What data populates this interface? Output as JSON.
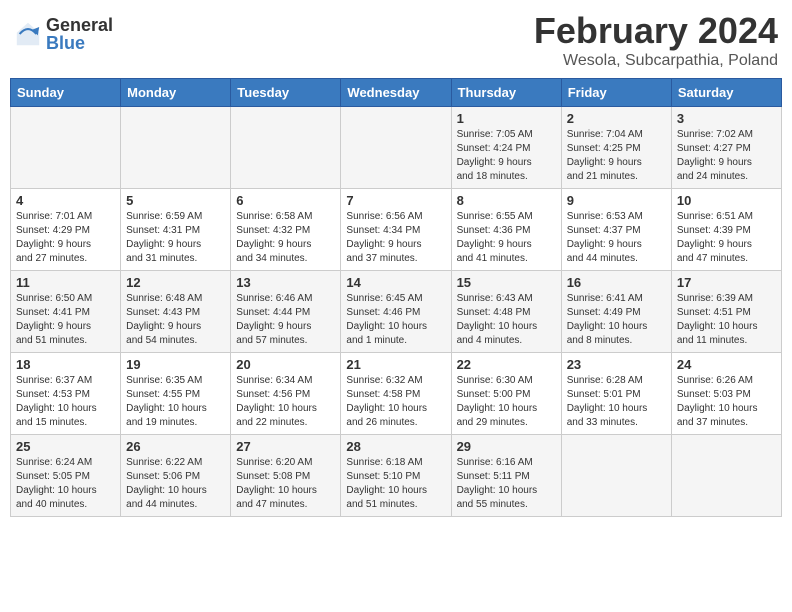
{
  "header": {
    "logo_general": "General",
    "logo_blue": "Blue",
    "month_title": "February 2024",
    "location": "Wesola, Subcarpathia, Poland"
  },
  "days_of_week": [
    "Sunday",
    "Monday",
    "Tuesday",
    "Wednesday",
    "Thursday",
    "Friday",
    "Saturday"
  ],
  "weeks": [
    [
      {
        "day": "",
        "info": ""
      },
      {
        "day": "",
        "info": ""
      },
      {
        "day": "",
        "info": ""
      },
      {
        "day": "",
        "info": ""
      },
      {
        "day": "1",
        "info": "Sunrise: 7:05 AM\nSunset: 4:24 PM\nDaylight: 9 hours\nand 18 minutes."
      },
      {
        "day": "2",
        "info": "Sunrise: 7:04 AM\nSunset: 4:25 PM\nDaylight: 9 hours\nand 21 minutes."
      },
      {
        "day": "3",
        "info": "Sunrise: 7:02 AM\nSunset: 4:27 PM\nDaylight: 9 hours\nand 24 minutes."
      }
    ],
    [
      {
        "day": "4",
        "info": "Sunrise: 7:01 AM\nSunset: 4:29 PM\nDaylight: 9 hours\nand 27 minutes."
      },
      {
        "day": "5",
        "info": "Sunrise: 6:59 AM\nSunset: 4:31 PM\nDaylight: 9 hours\nand 31 minutes."
      },
      {
        "day": "6",
        "info": "Sunrise: 6:58 AM\nSunset: 4:32 PM\nDaylight: 9 hours\nand 34 minutes."
      },
      {
        "day": "7",
        "info": "Sunrise: 6:56 AM\nSunset: 4:34 PM\nDaylight: 9 hours\nand 37 minutes."
      },
      {
        "day": "8",
        "info": "Sunrise: 6:55 AM\nSunset: 4:36 PM\nDaylight: 9 hours\nand 41 minutes."
      },
      {
        "day": "9",
        "info": "Sunrise: 6:53 AM\nSunset: 4:37 PM\nDaylight: 9 hours\nand 44 minutes."
      },
      {
        "day": "10",
        "info": "Sunrise: 6:51 AM\nSunset: 4:39 PM\nDaylight: 9 hours\nand 47 minutes."
      }
    ],
    [
      {
        "day": "11",
        "info": "Sunrise: 6:50 AM\nSunset: 4:41 PM\nDaylight: 9 hours\nand 51 minutes."
      },
      {
        "day": "12",
        "info": "Sunrise: 6:48 AM\nSunset: 4:43 PM\nDaylight: 9 hours\nand 54 minutes."
      },
      {
        "day": "13",
        "info": "Sunrise: 6:46 AM\nSunset: 4:44 PM\nDaylight: 9 hours\nand 57 minutes."
      },
      {
        "day": "14",
        "info": "Sunrise: 6:45 AM\nSunset: 4:46 PM\nDaylight: 10 hours\nand 1 minute."
      },
      {
        "day": "15",
        "info": "Sunrise: 6:43 AM\nSunset: 4:48 PM\nDaylight: 10 hours\nand 4 minutes."
      },
      {
        "day": "16",
        "info": "Sunrise: 6:41 AM\nSunset: 4:49 PM\nDaylight: 10 hours\nand 8 minutes."
      },
      {
        "day": "17",
        "info": "Sunrise: 6:39 AM\nSunset: 4:51 PM\nDaylight: 10 hours\nand 11 minutes."
      }
    ],
    [
      {
        "day": "18",
        "info": "Sunrise: 6:37 AM\nSunset: 4:53 PM\nDaylight: 10 hours\nand 15 minutes."
      },
      {
        "day": "19",
        "info": "Sunrise: 6:35 AM\nSunset: 4:55 PM\nDaylight: 10 hours\nand 19 minutes."
      },
      {
        "day": "20",
        "info": "Sunrise: 6:34 AM\nSunset: 4:56 PM\nDaylight: 10 hours\nand 22 minutes."
      },
      {
        "day": "21",
        "info": "Sunrise: 6:32 AM\nSunset: 4:58 PM\nDaylight: 10 hours\nand 26 minutes."
      },
      {
        "day": "22",
        "info": "Sunrise: 6:30 AM\nSunset: 5:00 PM\nDaylight: 10 hours\nand 29 minutes."
      },
      {
        "day": "23",
        "info": "Sunrise: 6:28 AM\nSunset: 5:01 PM\nDaylight: 10 hours\nand 33 minutes."
      },
      {
        "day": "24",
        "info": "Sunrise: 6:26 AM\nSunset: 5:03 PM\nDaylight: 10 hours\nand 37 minutes."
      }
    ],
    [
      {
        "day": "25",
        "info": "Sunrise: 6:24 AM\nSunset: 5:05 PM\nDaylight: 10 hours\nand 40 minutes."
      },
      {
        "day": "26",
        "info": "Sunrise: 6:22 AM\nSunset: 5:06 PM\nDaylight: 10 hours\nand 44 minutes."
      },
      {
        "day": "27",
        "info": "Sunrise: 6:20 AM\nSunset: 5:08 PM\nDaylight: 10 hours\nand 47 minutes."
      },
      {
        "day": "28",
        "info": "Sunrise: 6:18 AM\nSunset: 5:10 PM\nDaylight: 10 hours\nand 51 minutes."
      },
      {
        "day": "29",
        "info": "Sunrise: 6:16 AM\nSunset: 5:11 PM\nDaylight: 10 hours\nand 55 minutes."
      },
      {
        "day": "",
        "info": ""
      },
      {
        "day": "",
        "info": ""
      }
    ]
  ]
}
